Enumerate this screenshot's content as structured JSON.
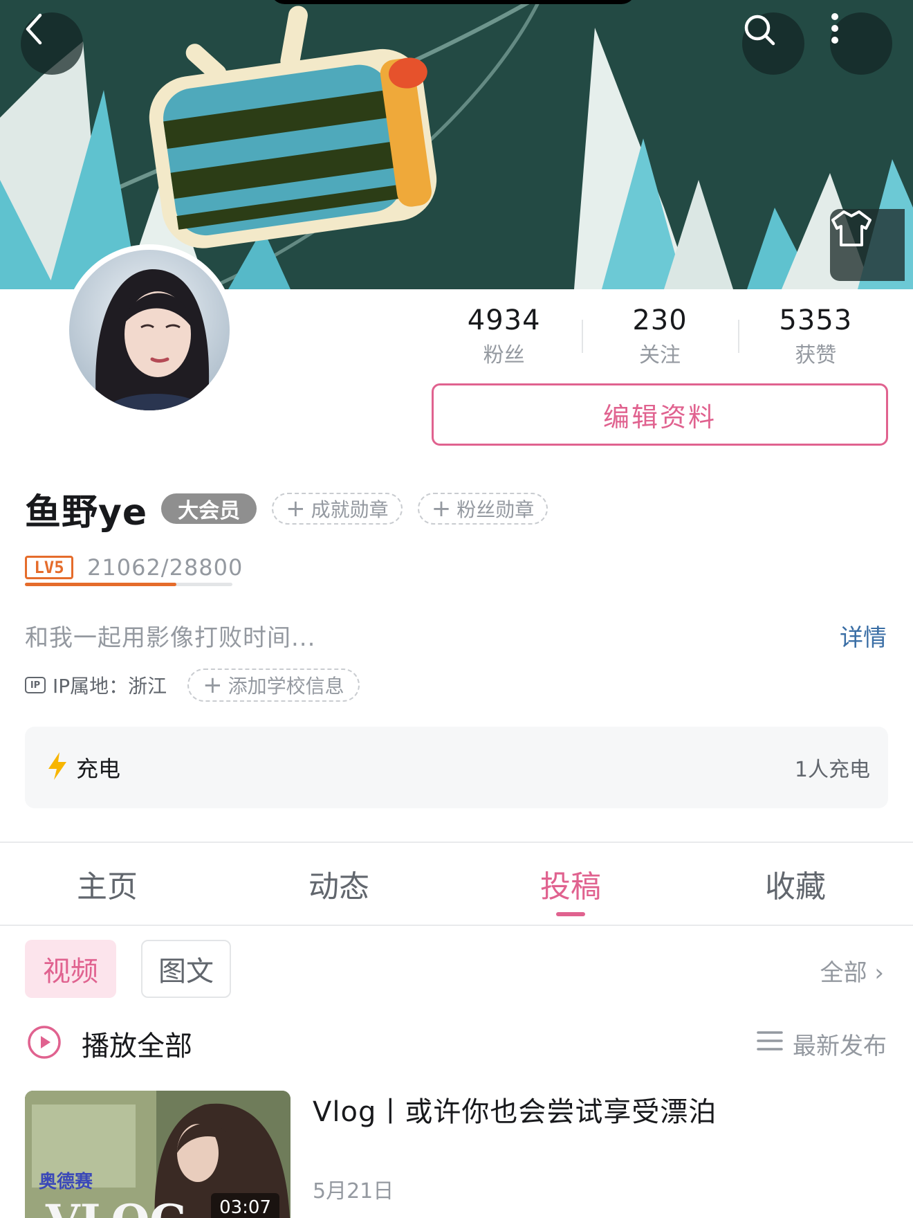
{
  "header": {
    "back_icon": "back-chevron-icon",
    "search_icon": "search-icon",
    "more_icon": "more-vertical-icon",
    "skin_icon": "tshirt-icon"
  },
  "stats": [
    {
      "value": "4934",
      "label": "粉丝"
    },
    {
      "value": "230",
      "label": "关注"
    },
    {
      "value": "5353",
      "label": "获赞"
    }
  ],
  "profile": {
    "edit_button": "编辑资料",
    "username": "鱼野ye",
    "vip_badge": "大会员",
    "medal_achievement": "成就勋章",
    "medal_fans": "粉丝勋章",
    "level_badge": "LV5",
    "level_progress": "21062/28800",
    "level_fraction": 0.731,
    "signature": "和我一起用影像打败时间...",
    "detail_link": "详情",
    "ip_badge": "IP",
    "ip_text": "IP属地：浙江",
    "add_school": "添加学校信息"
  },
  "charge": {
    "label": "充电",
    "count": "1人充电"
  },
  "tabs": [
    {
      "label": "主页",
      "active": false
    },
    {
      "label": "动态",
      "active": false
    },
    {
      "label": "投稿",
      "active": true
    },
    {
      "label": "收藏",
      "active": false
    }
  ],
  "filters": {
    "video": "视频",
    "image_text": "图文",
    "all": "全部 ›"
  },
  "playlist": {
    "play_all": "播放全部",
    "sort": "最新发布"
  },
  "video": {
    "title": "Vlog丨或许你也会尝试享受漂泊",
    "date": "5月21日",
    "duration": "03:07",
    "thumb_overlay_text": "奥德赛",
    "thumb_vlog_text": "VLOG"
  },
  "colors": {
    "accent": "#e0628f",
    "level": "#e56c2b",
    "link": "#3a6ea5",
    "charge_bolt": "#f7b500",
    "vip_badge_bg": "#8f8f8f"
  }
}
